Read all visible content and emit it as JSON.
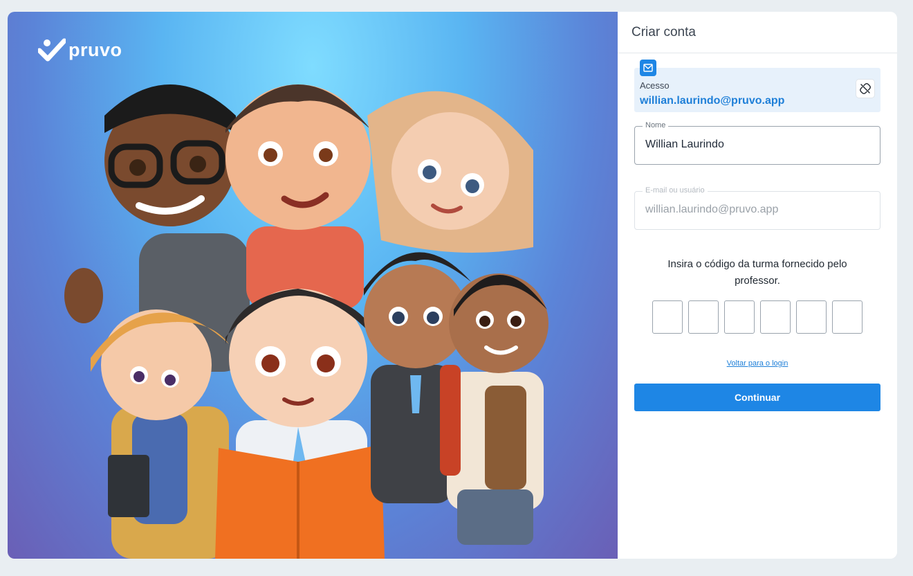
{
  "brand": {
    "name": "pruvo",
    "accent": "#1e86e5"
  },
  "header": {
    "title": "Criar conta"
  },
  "access": {
    "label": "Acesso",
    "email": "willian.laurindo@pruvo.app",
    "icon": "mail-icon",
    "action_icon": "unlink-icon"
  },
  "form": {
    "name": {
      "label": "Nome",
      "value": "Willian Laurindo"
    },
    "login": {
      "label": "E-mail ou usuário",
      "value": "willian.laurindo@pruvo.app"
    },
    "instruction": "Insira o código da turma fornecido pelo professor.",
    "code_slots": [
      "",
      "",
      "",
      "",
      "",
      ""
    ],
    "back_link": "Voltar para o login",
    "submit_label": "Continuar"
  }
}
